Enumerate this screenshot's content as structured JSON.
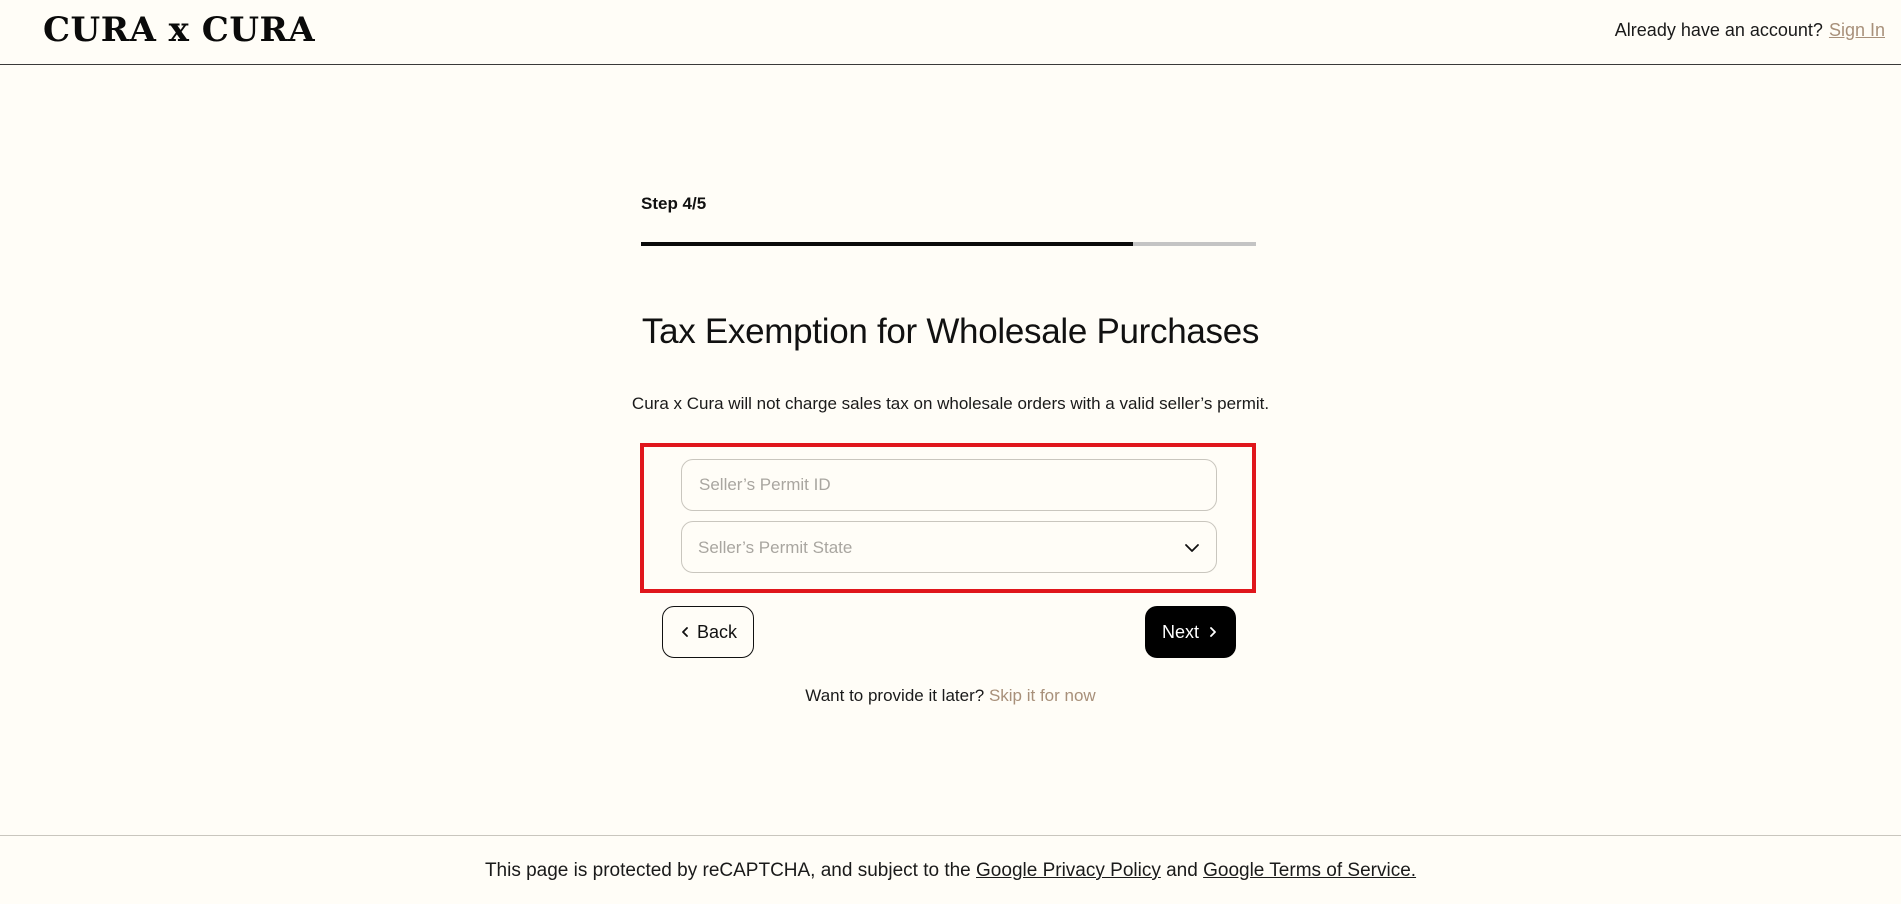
{
  "header": {
    "logo": "CURA x CURA",
    "account_prompt": "Already have an account?",
    "sign_in_label": "Sign In"
  },
  "progress": {
    "step_label": "Step 4/5",
    "fraction": 0.8
  },
  "form": {
    "title": "Tax Exemption for Wholesale Purchases",
    "subtitle": "Cura x Cura will not charge sales tax on wholesale orders with a valid seller’s permit.",
    "permit_id": {
      "value": "",
      "placeholder": "Seller’s Permit ID"
    },
    "permit_state": {
      "selected": "Seller’s Permit State"
    },
    "back_label": "Back",
    "next_label": "Next",
    "later_prompt": "Want to provide it later?",
    "skip_label": "Skip it for now"
  },
  "footer": {
    "text_before": "This page is protected by reCAPTCHA, and subject to the",
    "privacy_link": "Google Privacy Policy",
    "and_text": "and",
    "terms_link": "Google Terms of Service."
  },
  "colors": {
    "background": "#fffdf7",
    "accent_link": "#a8907a",
    "highlight": "#e0161c",
    "primary_button": "#000000"
  }
}
